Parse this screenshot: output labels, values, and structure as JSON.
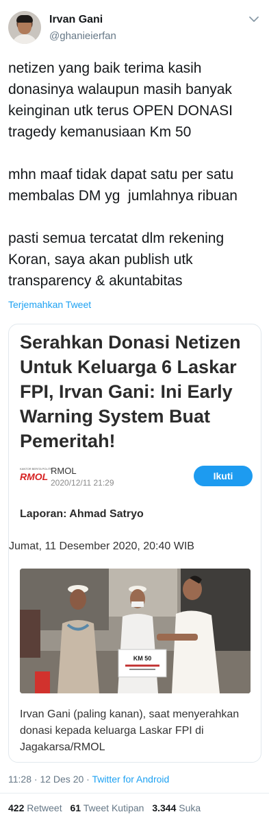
{
  "user": {
    "name": "Irvan Gani",
    "handle": "@ghanieierfan"
  },
  "tweet": {
    "paragraphs": [
      "netizen yang baik terima kasih donasinya walaupun masih banyak keinginan utk terus OPEN DONASI tragedy kemanusiaan Km 50",
      "mhn maaf tidak dapat satu per satu membalas DM yg  jumlahnya ribuan",
      "pasti semua tercatat dlm rekening Koran, saya akan publish utk transparency & akuntabitas"
    ],
    "translate_label": "Terjemahkan Tweet"
  },
  "card": {
    "title": "Serahkan Donasi Netizen Untuk Keluarga 6 Laskar FPI, Irvan Gani: Ini Early Warning System Buat Pemeritah!",
    "logo_word": "RMOL",
    "logo_tagline": "KANTOR BERITA POLITIK",
    "source_name": "RMOL",
    "source_date": "2020/12/11 21:29",
    "follow_label": "Ikuti",
    "reporter": "Laporan: Ahmad Satryo",
    "dateline": "Jumat, 11 Desember 2020, 20:40 WIB",
    "photo_sign": "KM 50",
    "caption": "Irvan Gani (paling kanan), saat menyerahkan donasi kepada keluarga Laskar FPI di Jagakarsa/RMOL"
  },
  "meta": {
    "time": "11:28",
    "separator": "·",
    "date": "12 Des 20",
    "client": "Twitter for Android"
  },
  "stats": {
    "retweets_count": "422",
    "retweets_label": "Retweet",
    "quotes_count": "61",
    "quotes_label": "Tweet Kutipan",
    "likes_count": "3.344",
    "likes_label": "Suka"
  },
  "colors": {
    "accent": "#1da1f2",
    "follow_button": "#1d9bf0",
    "secondary_text": "#657786",
    "rmol_red": "#d62222"
  },
  "icons": {
    "more": "chevron-down-icon"
  }
}
